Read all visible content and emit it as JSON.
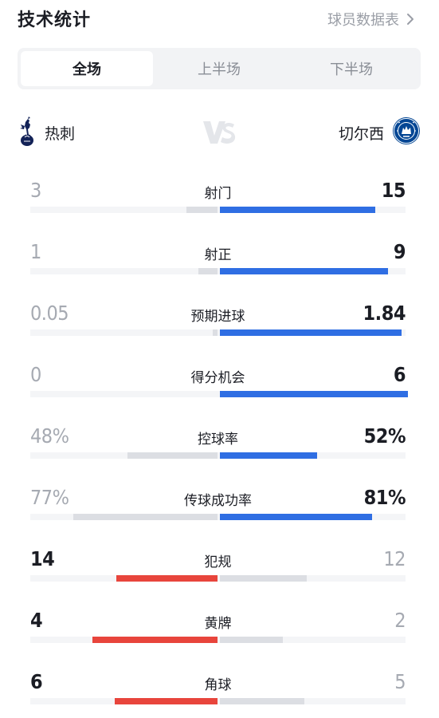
{
  "header": {
    "title": "技术统计",
    "player_sheet_link": "球员数据表",
    "chevron_icon": "chevron-right-icon"
  },
  "tabs": [
    {
      "label": "全场",
      "active": true
    },
    {
      "label": "上半场",
      "active": false
    },
    {
      "label": "下半场",
      "active": false
    }
  ],
  "teams": {
    "home": {
      "name": "热刺",
      "crest": "tottenham-crest-icon"
    },
    "away": {
      "name": "切尔西",
      "crest": "chelsea-crest-icon"
    },
    "vs_icon": "vs-icon"
  },
  "colors": {
    "blue": "#2f6ee3",
    "red": "#e8453c",
    "grey": "#dcdee3",
    "track": "#f4f5f7"
  },
  "stats": [
    {
      "label": "射门",
      "home": "3",
      "away": "15",
      "home_share": 0.0835,
      "away_share": 0.413,
      "leader": "away"
    },
    {
      "label": "射正",
      "home": "1",
      "away": "9",
      "home_share": 0.05,
      "away_share": 0.447,
      "leader": "away"
    },
    {
      "label": "预期进球",
      "home": "0.05",
      "away": "1.84",
      "home_share": 0.012,
      "away_share": 0.485,
      "leader": "away"
    },
    {
      "label": "得分机会",
      "home": "0",
      "away": "6",
      "home_share": 0.0,
      "away_share": 0.5,
      "leader": "away"
    },
    {
      "label": "控球率",
      "home": "48%",
      "away": "52%",
      "home_share": 0.24,
      "away_share": 0.26,
      "leader": "away"
    },
    {
      "label": "传球成功率",
      "home": "77%",
      "away": "81%",
      "home_share": 0.385,
      "away_share": 0.405,
      "leader": "away"
    },
    {
      "label": "犯规",
      "home": "14",
      "away": "12",
      "home_share": 0.27,
      "away_share": 0.231,
      "leader": "home"
    },
    {
      "label": "黄牌",
      "home": "4",
      "away": "2",
      "home_share": 0.333,
      "away_share": 0.167,
      "leader": "home"
    },
    {
      "label": "角球",
      "home": "6",
      "away": "5",
      "home_share": 0.273,
      "away_share": 0.226,
      "leader": "home"
    }
  ]
}
